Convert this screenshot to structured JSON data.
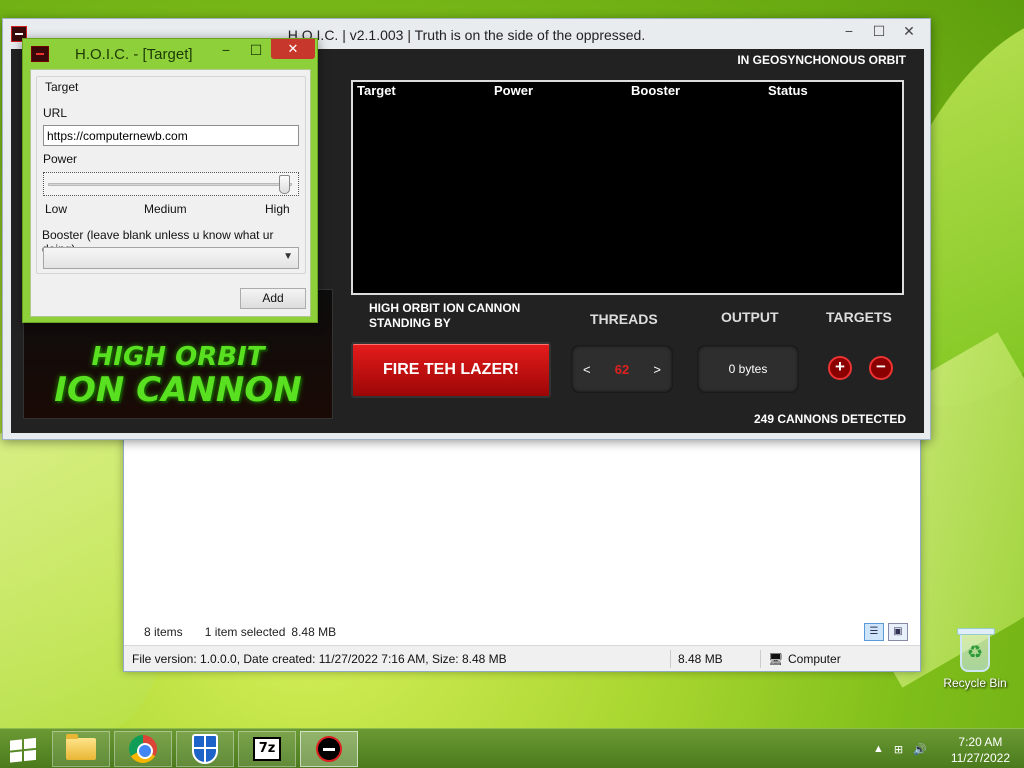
{
  "explorer": {
    "items_count": "8 items",
    "selected": "1 item selected",
    "selected_size": "8.48 MB",
    "status_file_info": "File version: 1.0.0.0, Date created: 11/27/2022 7:16 AM, Size: 8.48 MB",
    "status_size": "8.48 MB",
    "status_location": "Computer"
  },
  "main_window": {
    "title": "H.O.I.C. | v2.1.003 | Truth is on the side of the oppressed.",
    "controls": {
      "minimize": "−",
      "maximize": "☐",
      "close": "✕"
    },
    "orbit_status": "IN GEOSYNCHONOUS ORBIT",
    "logo": {
      "line1": "HIGH ORBIT",
      "line2": "ION CANNON"
    },
    "table": {
      "headers": [
        "Target",
        "Power",
        "Booster",
        "Status"
      ],
      "rows": []
    },
    "status_line1": "HIGH ORBIT ION CANNON",
    "status_line2": "STANDING BY",
    "fire_button": "FIRE TEH LAZER!",
    "threads_label": "THREADS",
    "threads_value": "62",
    "threads_dec": "<",
    "threads_inc": ">",
    "output_label": "OUTPUT",
    "output_value": "0 bytes",
    "targets_label": "TARGETS",
    "add_target": "+",
    "remove_target": "−",
    "cannons_detected": "249 CANNONS DETECTED"
  },
  "target_dialog": {
    "title": "H.O.I.C. - [Target]",
    "controls": {
      "minimize": "−",
      "maximize": "☐",
      "close": "✕"
    },
    "group_label": "Target",
    "url_label": "URL",
    "url_value": "https://computernewb.com",
    "power_label": "Power",
    "power_level": 1.0,
    "power_low": "Low",
    "power_medium": "Medium",
    "power_high": "High",
    "booster_label": "Booster (leave blank unless u know what ur doing)",
    "booster_value": "",
    "add_button": "Add"
  },
  "desktop": {
    "recycle_bin": "Recycle Bin"
  },
  "taskbar": {
    "apps": [
      "file-explorer-icon",
      "chrome-icon",
      "windows-defender-icon",
      "7zip-icon",
      "hoic-icon"
    ],
    "zip_text": "7z",
    "tray_arrow": "▲",
    "clock_time": "7:20 AM",
    "clock_date": "11/27/2022"
  },
  "colors": {
    "accent_red": "#d01010",
    "logo_green": "#59e021",
    "dialog_frame": "#8dd03a"
  }
}
